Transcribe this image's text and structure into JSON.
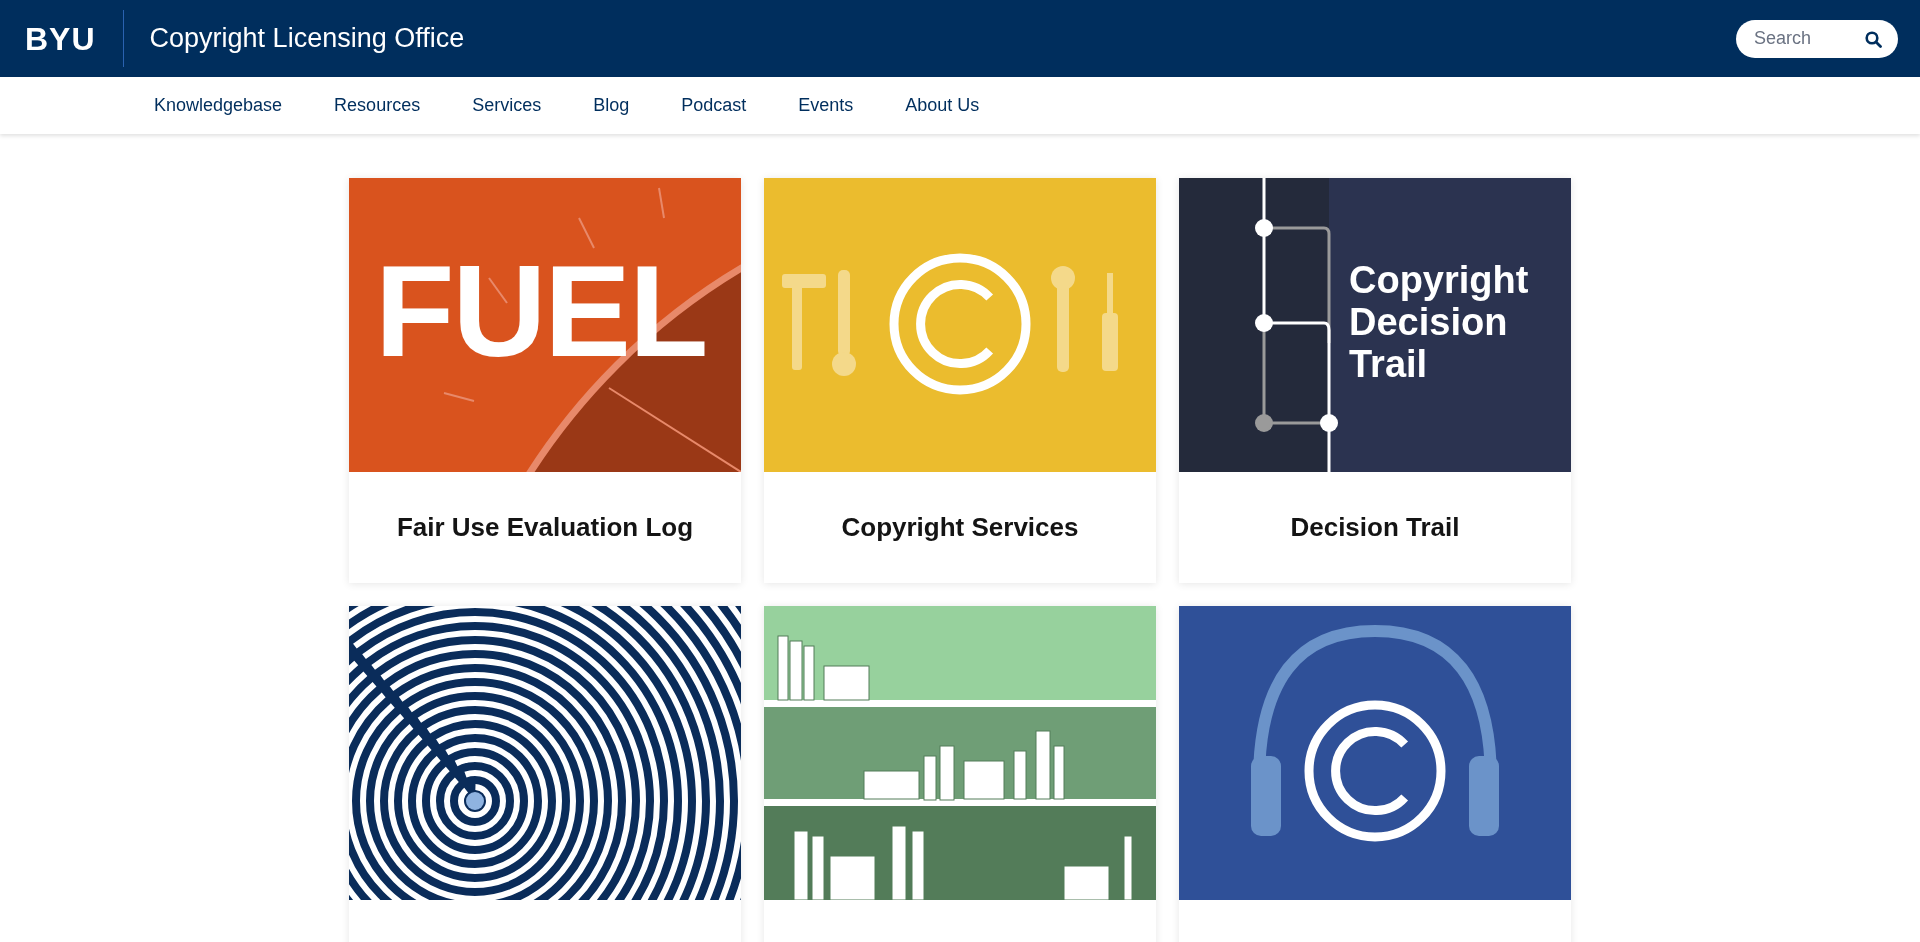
{
  "header": {
    "logo": "BYU",
    "title": "Copyright Licensing Office",
    "search": {
      "placeholder": "Search"
    }
  },
  "nav": [
    {
      "label": "Knowledgebase"
    },
    {
      "label": "Resources"
    },
    {
      "label": "Services"
    },
    {
      "label": "Blog"
    },
    {
      "label": "Podcast"
    },
    {
      "label": "Events"
    },
    {
      "label": "About Us"
    }
  ],
  "cards": [
    {
      "kind": "fuel",
      "title": "Fair Use Evaluation Log",
      "art_text": "FUEL"
    },
    {
      "kind": "tools",
      "title": "Copyright Services"
    },
    {
      "kind": "trail",
      "title": "Decision Trail",
      "art_text": "Copyright Decision Trail"
    },
    {
      "kind": "maze"
    },
    {
      "kind": "shelves"
    },
    {
      "kind": "headphones"
    }
  ]
}
